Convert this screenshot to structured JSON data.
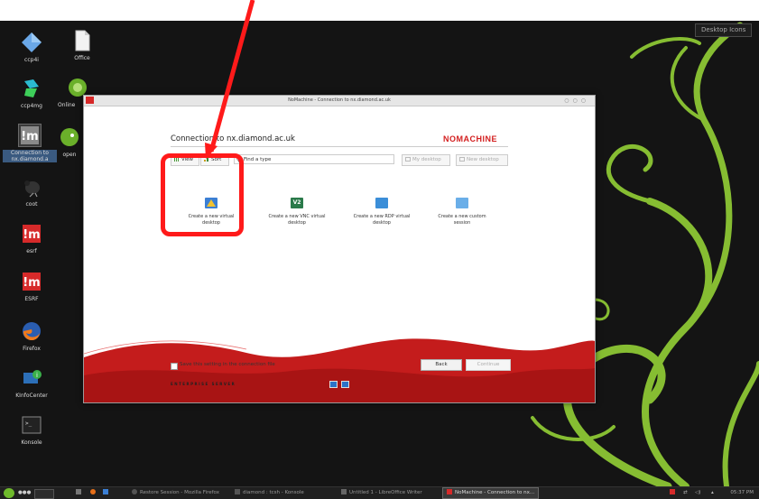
{
  "desktop": {
    "top_button": "Desktop Icons",
    "icons": [
      {
        "label": "ccp4i",
        "icon": "ccp4i-icon"
      },
      {
        "label": "Office",
        "icon": "document-icon"
      },
      {
        "label": "ccp4mg",
        "icon": "ccp4mg-icon"
      },
      {
        "label": "Online",
        "icon": "online-icon"
      },
      {
        "label": "Connection to nx.diamond.a",
        "icon": "nomachine-icon"
      },
      {
        "label": "open",
        "icon": "opensuse-icon"
      },
      {
        "label": "coot",
        "icon": "coot-icon"
      },
      {
        "label": "esrf",
        "icon": "nomachine-icon"
      },
      {
        "label": "ESRF",
        "icon": "nomachine-icon"
      },
      {
        "label": "Firefox",
        "icon": "firefox-icon"
      },
      {
        "label": "KInfoCenter",
        "icon": "kinfocenter-icon"
      },
      {
        "label": "Konsole",
        "icon": "terminal-icon"
      }
    ]
  },
  "window": {
    "title": "NoMachine - Connection to nx.diamond.ac.uk",
    "heading": "Connection to nx.diamond.ac.uk",
    "logo": "NOMACHINE",
    "toolbar": {
      "view": "View",
      "sort": "Sort",
      "find_placeholder": "Find a type",
      "my_desktop": "My desktop",
      "new_desktop": "New desktop"
    },
    "options": [
      {
        "label": "Create a new virtual desktop",
        "icon": "virtual-desktop-icon",
        "color": "#3b7fd4"
      },
      {
        "label": "Create a new VNC virtual desktop",
        "icon": "vnc-icon",
        "color": "#2a8a5a"
      },
      {
        "label": "Create a new RDP virtual desktop",
        "icon": "rdp-icon",
        "color": "#3b8ed8"
      },
      {
        "label": "Create a new custom session",
        "icon": "custom-session-icon",
        "color": "#5aa0e0"
      }
    ],
    "save_setting": "Save this setting in the connection file",
    "back": "Back",
    "continue": "Continue",
    "footer": "ENTERPRISE SERVER"
  },
  "taskbar": {
    "tasks": [
      "Restore Session - Mozilla Firefox",
      "diamond : tcsh - Konsole",
      "Untitled 1 - LibreOffice Writer",
      "NoMachine - Connection to nx..."
    ],
    "clock": "05:37 PM"
  },
  "colors": {
    "accent": "#d31e1e",
    "highlight": "#ff1a1a",
    "swirl": "#8fc33a"
  }
}
